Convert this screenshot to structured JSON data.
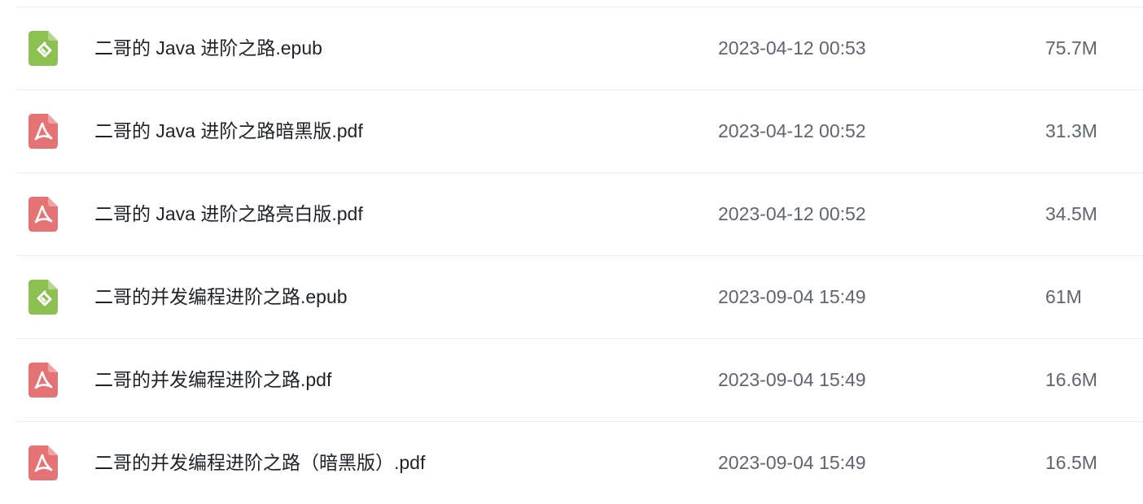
{
  "colors": {
    "epub_icon": "#8cc152",
    "pdf_icon": "#e57373",
    "name_text": "#1f2329",
    "meta_text": "#5f6470",
    "divider": "#ededf0"
  },
  "files": [
    {
      "name": "二哥的 Java 进阶之路.epub",
      "date": "2023-04-12 00:53",
      "size": "75.7M",
      "icon": "epub-icon"
    },
    {
      "name": "二哥的 Java 进阶之路暗黑版.pdf",
      "date": "2023-04-12 00:52",
      "size": "31.3M",
      "icon": "pdf-icon"
    },
    {
      "name": "二哥的 Java 进阶之路亮白版.pdf",
      "date": "2023-04-12 00:52",
      "size": "34.5M",
      "icon": "pdf-icon"
    },
    {
      "name": "二哥的并发编程进阶之路.epub",
      "date": "2023-09-04 15:49",
      "size": "61M",
      "icon": "epub-icon"
    },
    {
      "name": "二哥的并发编程进阶之路.pdf",
      "date": "2023-09-04 15:49",
      "size": "16.6M",
      "icon": "pdf-icon"
    },
    {
      "name": "二哥的并发编程进阶之路（暗黑版）.pdf",
      "date": "2023-09-04 15:49",
      "size": "16.5M",
      "icon": "pdf-icon"
    }
  ]
}
